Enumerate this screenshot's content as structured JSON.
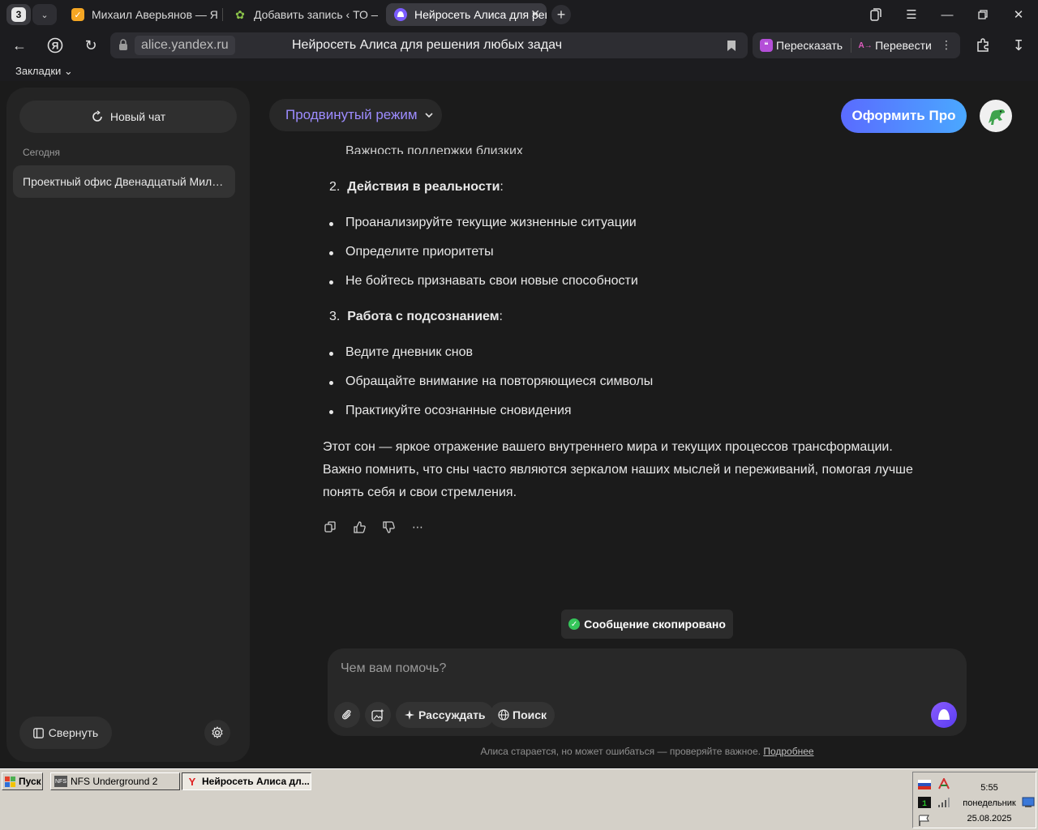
{
  "browser": {
    "tab_count": "3",
    "tabs": [
      {
        "title": "Михаил Аверьянов — Я"
      },
      {
        "title": "Добавить запись ‹ ТО — W"
      },
      {
        "title": "Нейросеть Алиса для решения любых задач"
      }
    ],
    "url_domain": "alice.yandex.ru",
    "page_title": "Нейросеть Алиса для решения любых задач",
    "ext_retell": "Пересказать",
    "ext_translate": "Перевести",
    "bookmarks_label": "Закладки"
  },
  "sidebar": {
    "new_chat": "Новый чат",
    "section_today": "Сегодня",
    "chat_item": "Проектный офис Двенадцатый Миллиард",
    "collapse": "Свернуть"
  },
  "header": {
    "mode": "Продвинутый режим",
    "pro": "Оформить Про"
  },
  "message": {
    "cut_bullet": "Важность поддержки близких",
    "item2_num": "2.",
    "item2_title": "Действия в реальности",
    "item2_bullets": [
      "Проанализируйте текущие жизненные ситуации",
      "Определите приоритеты",
      "Не бойтесь признавать свои новые способности"
    ],
    "item3_num": "3.",
    "item3_title": "Работа с подсознанием",
    "item3_bullets": [
      "Ведите дневник снов",
      "Обращайте внимание на повторяющиеся символы",
      "Практикуйте осознанные сновидения"
    ],
    "paragraph": "Этот сон — яркое отражение вашего внутреннего мира и текущих процессов трансформации. Важно помнить, что сны часто являются зеркалом наших мыслей и переживаний, помогая лучше понять себя и свои стремления."
  },
  "toast": "Сообщение скопировано",
  "composer": {
    "placeholder": "Чем вам помочь?",
    "reason": "Рассуждать",
    "search": "Поиск"
  },
  "disclaimer": {
    "text": "Алиса старается, но может ошибаться — проверяйте важное.",
    "link": "Подробнее"
  },
  "taskbar": {
    "start": "Пуск",
    "tasks": [
      "NFS Underground 2",
      "Нейросеть Алиса дл..."
    ],
    "time": "5:55",
    "weekday": "понедельник",
    "date": "25.08.2025"
  },
  "colors": {
    "accent_purple": "#9d8cff",
    "pro_gradient_start": "#5a6bff",
    "pro_gradient_end": "#4aa8ff",
    "success_green": "#35c55a"
  }
}
